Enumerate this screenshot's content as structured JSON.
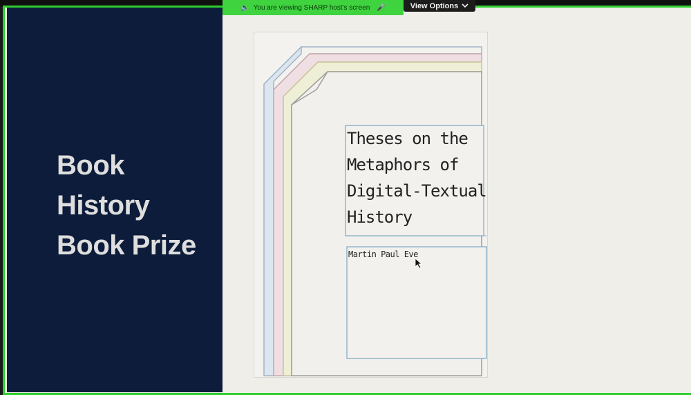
{
  "meeting": {
    "share_banner_text": "You are viewing  SHARP host's screen",
    "view_options_label": "View Options",
    "speaker_icon": "speaker-icon",
    "mic_icon": "microphone-icon",
    "chevron_icon": "chevron-down-icon"
  },
  "slide": {
    "title_lines": [
      "Book",
      "History",
      "Book Prize"
    ],
    "book": {
      "title_lines": [
        "Theses on the",
        "Metaphors of",
        "Digital-Textual",
        "History"
      ],
      "author": "Martin Paul Eve"
    }
  },
  "colors": {
    "share_green": "#3fd33f",
    "panel_navy": "#0c1c3a",
    "title_text": "#dedede",
    "cover_paper": "#f3f2ee"
  }
}
